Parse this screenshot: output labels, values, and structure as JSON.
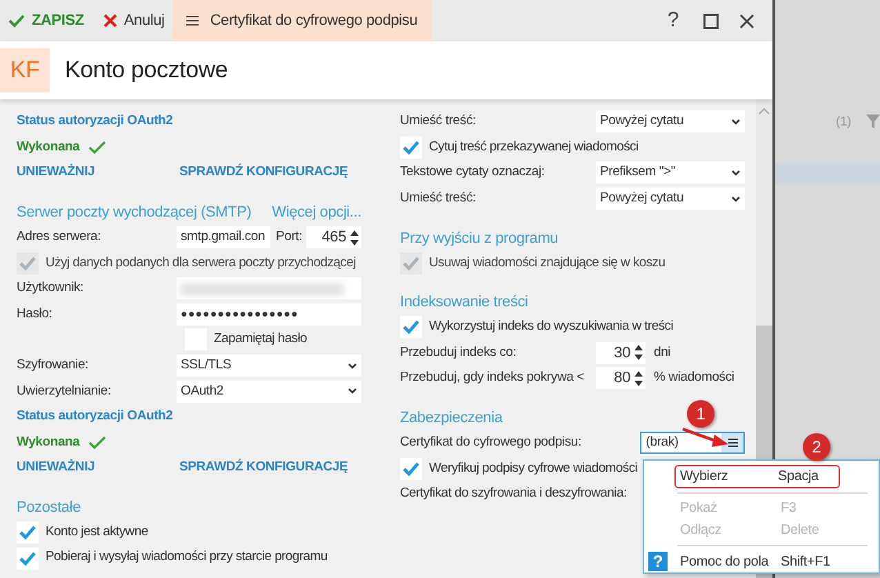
{
  "toolbar": {
    "save": "ZAPISZ",
    "cancel": "Anuluj",
    "tab": {
      "label": "Certyfikat do cyfrowego podpisu",
      "selected": true
    },
    "window_buttons": [
      "?"
    ]
  },
  "header": {
    "badge": "KF",
    "title": "Konto pocztowe"
  },
  "left_column": [
    {
      "kind": "link_heading",
      "text": "Status autoryzacji OAuth2"
    },
    {
      "kind": "status",
      "text": "Wykonana"
    },
    {
      "kind": "actions",
      "links": [
        "UNIEWAŻNIJ",
        "SPRAWDŹ KONFIGURACJĘ"
      ]
    },
    {
      "kind": "section",
      "text": "Serwer poczty wychodzącej (SMTP)",
      "link": "Więcej opcji..."
    },
    {
      "kind": "server",
      "label": "Adres serwera:",
      "value": "smtp.gmail.con",
      "port_label": "Port:",
      "port": "465"
    },
    {
      "kind": "checkbox",
      "label": "Użyj danych podanych dla serwera poczty przychodzącej",
      "checked": true,
      "disabled": true
    },
    {
      "kind": "redacted",
      "label": "Użytkownik:"
    },
    {
      "kind": "text",
      "label": "Hasło:",
      "value": "●●●●●●●●●●●●●●●●"
    },
    {
      "kind": "checkbox_indent",
      "label": "Zapamiętaj hasło",
      "checked": false,
      "disabled": false
    },
    {
      "kind": "select",
      "label": "Szyfrowanie:",
      "value": "SSL/TLS"
    },
    {
      "kind": "select",
      "label": "Uwierzytelnianie:",
      "value": "OAuth2"
    },
    {
      "kind": "link_heading",
      "text": "Status autoryzacji OAuth2"
    },
    {
      "kind": "status",
      "text": "Wykonana"
    },
    {
      "kind": "actions",
      "links": [
        "UNIEWAŻNIJ",
        "SPRAWDŹ KONFIGURACJĘ"
      ]
    },
    {
      "kind": "section",
      "text": "Pozostałe"
    },
    {
      "kind": "checkbox",
      "label": "Konto jest aktywne",
      "checked": true,
      "disabled": false
    },
    {
      "kind": "checkbox",
      "label": "Pobieraj i wysyłaj wiadomości przy starcie programu",
      "checked": true,
      "disabled": false
    }
  ],
  "right_column": [
    {
      "kind": "select",
      "label": "Umieść treść:",
      "value": "Powyżej cytatu"
    },
    {
      "kind": "checkbox",
      "label": "Cytuj treść przekazywanej wiadomości",
      "checked": true,
      "disabled": false
    },
    {
      "kind": "select",
      "label": "Tekstowe cytaty oznaczaj:",
      "value": "Prefiksem \">\""
    },
    {
      "kind": "select",
      "label": "Umieść treść:",
      "value": "Powyżej cytatu"
    },
    {
      "kind": "section",
      "text": "Przy wyjściu z programu"
    },
    {
      "kind": "checkbox",
      "label": "Usuwaj wiadomości znajdujące się w koszu",
      "checked": true,
      "disabled": true
    },
    {
      "kind": "section",
      "text": "Indeksowanie treści"
    },
    {
      "kind": "checkbox",
      "label": "Wykorzystuj indeks do wyszukiwania w treści",
      "checked": true,
      "disabled": false
    },
    {
      "kind": "spinner",
      "label": "Przebuduj indeks co:",
      "value": "30",
      "suffix": "dni"
    },
    {
      "kind": "spinner",
      "label": "Przebuduj, gdy indeks pokrywa <",
      "value": "80",
      "suffix": "% wiadomości"
    },
    {
      "kind": "section",
      "text": "Zabezpieczenia"
    },
    {
      "kind": "cert",
      "label": "Certyfikat do cyfrowego podpisu:",
      "value": "(brak)"
    },
    {
      "kind": "checkbox",
      "label": "Weryfikuj podpisy cyfrowe wiadomości",
      "checked": true,
      "disabled": false
    },
    {
      "kind": "label",
      "label": "Certyfikat do szyfrowania i deszyfrowania:"
    }
  ],
  "dropdown_menu": [
    {
      "kind": "item",
      "label": "Wybierz",
      "shortcut": "Spacja",
      "disabled": false,
      "highlighted": true
    },
    {
      "kind": "separator"
    },
    {
      "kind": "item",
      "label": "Pokaż",
      "shortcut": "F3",
      "disabled": true,
      "highlighted": false
    },
    {
      "kind": "item",
      "label": "Odłącz",
      "shortcut": "Delete",
      "disabled": true,
      "highlighted": false
    },
    {
      "kind": "separator"
    },
    {
      "kind": "help",
      "icon": "?",
      "label": "Pomoc do pola",
      "shortcut": "Shift+F1",
      "disabled": false,
      "highlighted": false
    }
  ],
  "callouts": [
    "1",
    "2"
  ],
  "background": {
    "count": "(1)"
  }
}
